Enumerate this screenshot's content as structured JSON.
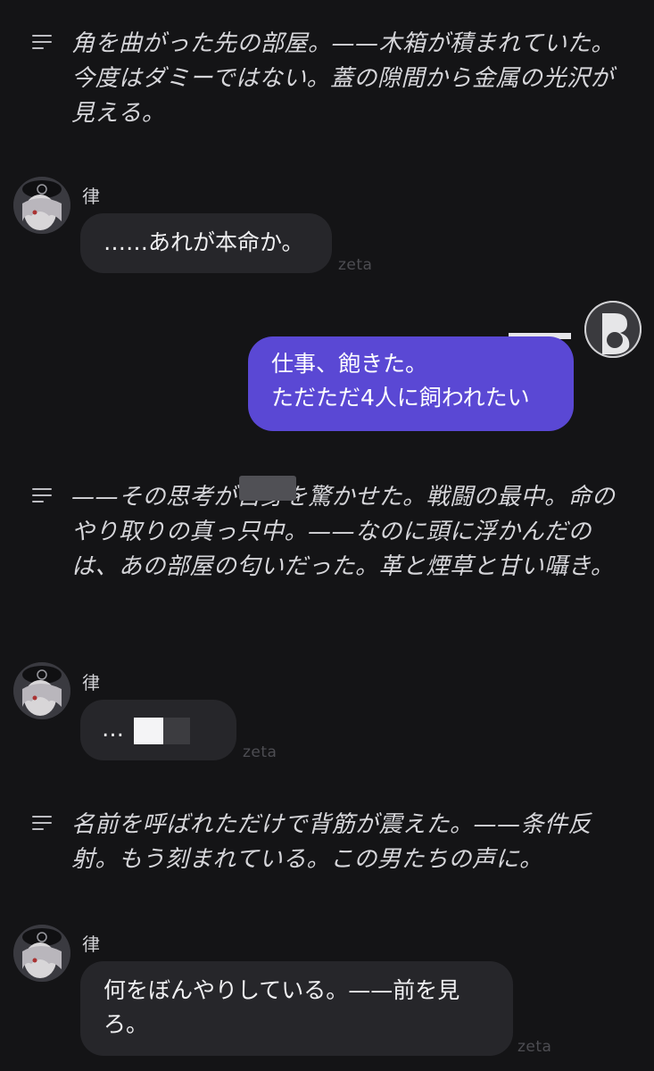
{
  "narrations": [
    {
      "text": "角を曲がった先の部屋。——木箱が積まれていた。今度はダミーではない。蓋の隙間から金属の光沢が見える。"
    },
    {
      "text": "——その思考が自身を驚かせた。戦闘の最中。命のやり取りの真っ只中。——なのに頭に浮かんだのは、あの部屋の匂いだった。革と煙草と甘い囁き。"
    },
    {
      "text": "名前を呼ばれただけで背筋が震えた。——条件反射。もう刻まれている。この男たちの声に。"
    }
  ],
  "messages": [
    {
      "speaker": "律",
      "text": "……あれが本命か。",
      "source": "zeta"
    },
    {
      "speaker": "律",
      "text": "…",
      "source": "zeta"
    },
    {
      "speaker": "律",
      "text": "何をぼんやりしている。——前を見ろ。",
      "source": "zeta"
    }
  ],
  "user_message": {
    "line1": "仕事、飽きた。",
    "line2": "ただただ4人に飼われたい"
  },
  "colors": {
    "background": "#141416",
    "bubble": "#26262a",
    "user_bubble": "#5a48d4",
    "narration_text": "#d6d6da"
  },
  "icons": {
    "narration": "narration-lines-icon",
    "character_avatar": "character-avatar",
    "user_avatar": "user-avatar"
  }
}
